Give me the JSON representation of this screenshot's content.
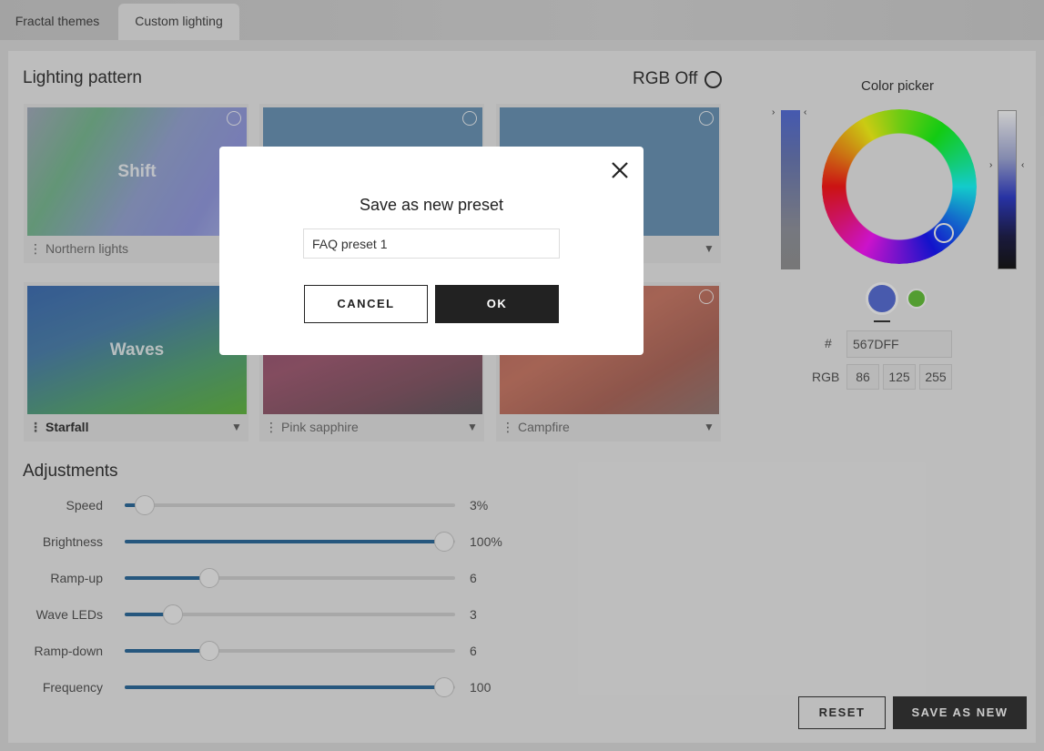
{
  "tabs": [
    {
      "label": "Fractal themes"
    },
    {
      "label": "Custom lighting"
    }
  ],
  "lighting": {
    "title": "Lighting pattern",
    "rgb_off_label": "RGB Off",
    "cards": [
      {
        "art_label": "Shift",
        "name": "Northern lights"
      },
      {
        "art_label": "",
        "name": ""
      },
      {
        "art_label": "",
        "name": ""
      },
      {
        "art_label": "Waves",
        "name": "Starfall"
      },
      {
        "art_label": "",
        "name": "Pink sapphire"
      },
      {
        "art_label": "",
        "name": "Campfire"
      }
    ]
  },
  "adjustments": {
    "title": "Adjustments",
    "rows": [
      {
        "label": "Speed",
        "value_text": "3%",
        "fraction": 0.03
      },
      {
        "label": "Brightness",
        "value_text": "100%",
        "fraction": 1.0
      },
      {
        "label": "Ramp-up",
        "value_text": "6",
        "fraction": 0.24
      },
      {
        "label": "Wave LEDs",
        "value_text": "3",
        "fraction": 0.12
      },
      {
        "label": "Ramp-down",
        "value_text": "6",
        "fraction": 0.24
      },
      {
        "label": "Frequency",
        "value_text": "100",
        "fraction": 1.0
      }
    ]
  },
  "color_picker": {
    "title": "Color picker",
    "hash_label": "#",
    "hex": "567DFF",
    "rgb_label": "RGB",
    "r": "86",
    "g": "125",
    "b": "255",
    "primary_color": "#4a63d6",
    "secondary_color": "#59c02a"
  },
  "buttons": {
    "reset": "RESET",
    "save_as_new": "SAVE AS NEW"
  },
  "modal": {
    "title": "Save as new preset",
    "input_value": "FAQ preset 1",
    "cancel": "CANCEL",
    "ok": "OK"
  },
  "icons": {
    "close": "close-icon",
    "card_menu": "vertical-dots-icon",
    "card_expand": "chevron-down-icon",
    "card_select": "radio-circle-icon"
  }
}
